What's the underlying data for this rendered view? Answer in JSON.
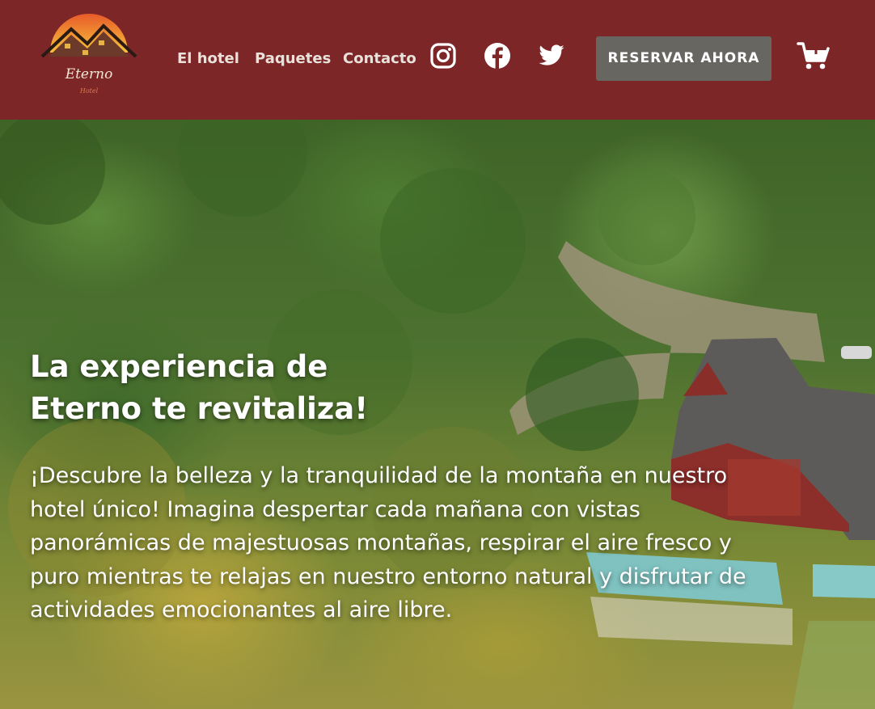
{
  "brand": {
    "name": "Eterno",
    "subtitle": "Hotel",
    "logo_icon": "mountain-roof-sun-icon",
    "color_header": "#7d2628",
    "color_cta": "#686660"
  },
  "nav": {
    "links": [
      {
        "label": "El hotel"
      },
      {
        "label": "Paquetes"
      },
      {
        "label": "Contacto"
      }
    ],
    "social_icons": [
      "instagram-icon",
      "facebook-icon",
      "twitter-icon"
    ],
    "cta_label": "RESERVAR AHORA",
    "cart_icon": "cart-add-icon"
  },
  "hero": {
    "title_line1": "La experiencia de",
    "title_line2": "Eterno te revitaliza!",
    "body": "¡Descubre la belleza y la tranquilidad de la montaña en nuestro hotel único! Imagina despertar cada mañana con vistas panorámicas de majestuosas montañas, respirar el aire fresco y puro mientras te relajas en nuestro entorno natural y disfrutar de actividades emocionantes al aire libre."
  }
}
